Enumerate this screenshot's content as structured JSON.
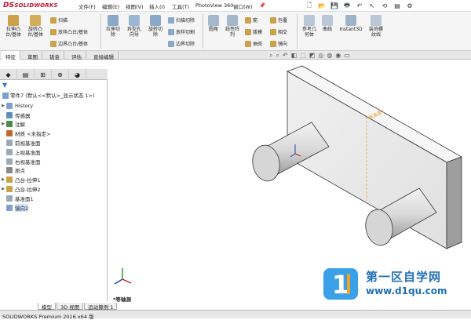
{
  "app": {
    "logo_ds": "DS",
    "logo_name": "SOLIDWORKS"
  },
  "menu": [
    "文件(F)",
    "编辑(E)",
    "视图(V)",
    "插入(I)",
    "工具(T)",
    "PhotoView 360",
    "窗口(W)"
  ],
  "ribbon": {
    "extrude_boss": "拉伸凸\n台/基体",
    "revolve_boss": "旋转凸\n台/基体",
    "sweep": "扫描",
    "loft_boss": "放样凸台/基体",
    "boundary_boss": "边界凸台/基体",
    "extrude_cut": "拉伸切\n除",
    "hole_wizard": "异型孔\n向导",
    "revolve_cut": "旋转切\n除",
    "sweep_cut": "扫描切除",
    "loft_cut": "放样切割",
    "boundary_cut": "边界切除",
    "fillet": "圆角",
    "linear_pattern": "线性阵\n列",
    "rib": "筋",
    "draft": "拔模",
    "shell": "抽壳",
    "wrap": "包覆",
    "intersect": "相交",
    "mirror": "镜向",
    "ref_geometry": "参考几\n何体",
    "curves": "曲线",
    "instant3d": "Instant3D",
    "thread": "装饰螺\n纹线"
  },
  "tabs": [
    "特征",
    "草图",
    "钣金",
    "评估",
    "直接编辑"
  ],
  "active_tab": "特征",
  "tree": {
    "root": "零件7  (默认<<默认>_显示状态 1>)",
    "items": [
      {
        "label": "History",
        "expand": true
      },
      {
        "label": "传感器",
        "expand": false
      },
      {
        "label": "注解",
        "expand": true
      },
      {
        "label": "材质 <未指定>",
        "expand": false
      },
      {
        "label": "前视基准面",
        "expand": false
      },
      {
        "label": "上视基准面",
        "expand": false
      },
      {
        "label": "右视基准面",
        "expand": false
      },
      {
        "label": "原点",
        "expand": false
      },
      {
        "label": "凸台-拉伸1",
        "expand": true
      },
      {
        "label": "凸台-拉伸2",
        "expand": true
      },
      {
        "label": "基准面1",
        "expand": false
      },
      {
        "label": "镜向2",
        "expand": false,
        "selected": true
      }
    ]
  },
  "viewport": {
    "plane_label": "基准面1",
    "view_name": "*等轴测"
  },
  "bottom_tabs": [
    "模型",
    "3D 视图",
    "运动算例 1"
  ],
  "active_bottom_tab": "模型",
  "status": "SOLIDWORKS Premium 2016 x64 版",
  "watermark": {
    "title": "第一区自学网",
    "url": "www.d1qu.com"
  },
  "colors": {
    "accent": "#3a7bc8",
    "logo": "#c8102e",
    "plane": "#e8a33a",
    "watermark": "#1f6fb5"
  }
}
